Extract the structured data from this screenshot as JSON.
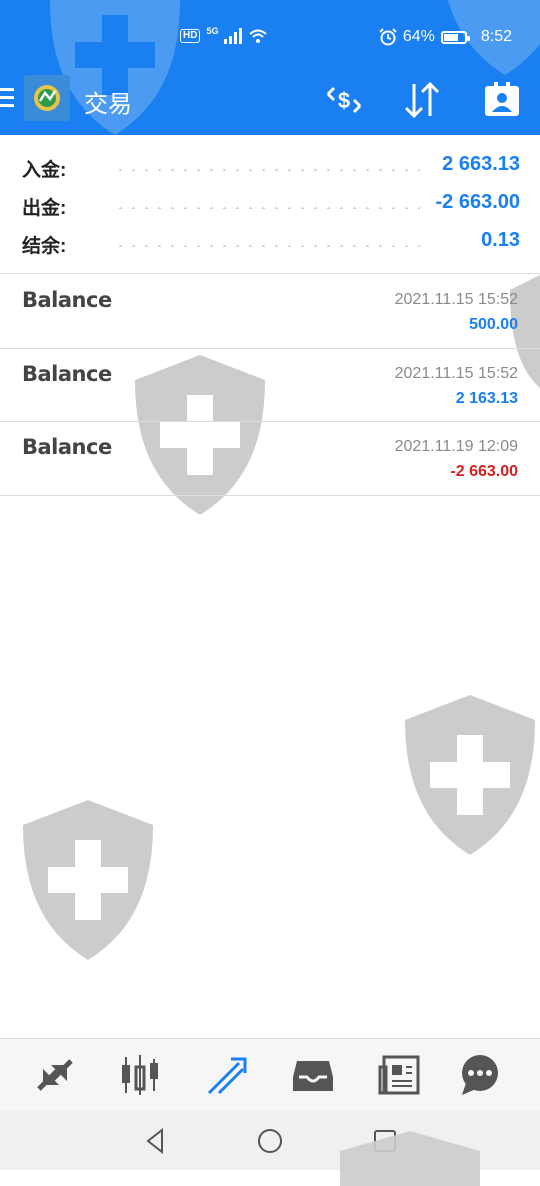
{
  "status_bar": {
    "network_badge": "HD",
    "network_type": "5G",
    "battery_percent": "64%",
    "battery_level": 0.64,
    "time": "8:52"
  },
  "app_bar": {
    "title": "交易",
    "icons": [
      "menu-icon",
      "app-logo",
      "exchange-dollar-icon",
      "sort-arrows-icon",
      "contact-card-icon"
    ]
  },
  "summary": {
    "deposit_label": "入金:",
    "deposit_value": "2 663.13",
    "withdraw_label": "出金:",
    "withdraw_value": "-2 663.00",
    "balance_label": "结余:",
    "balance_value": "0.13"
  },
  "entries": [
    {
      "type": "Balance",
      "time": "2021.11.15 15:52",
      "amount": "500.00",
      "sign": "positive"
    },
    {
      "type": "Balance",
      "time": "2021.11.15 15:52",
      "amount": "2 163.13",
      "sign": "positive"
    },
    {
      "type": "Balance",
      "time": "2021.11.19 12:09",
      "amount": "-2 663.00",
      "sign": "negative"
    }
  ],
  "bottom_nav": {
    "items": [
      "quotes-icon",
      "chart-candles-icon",
      "trade-icon",
      "history-inbox-icon",
      "news-icon",
      "chat-icon"
    ],
    "active": "trade-icon"
  },
  "colors": {
    "accent": "#1a7ff0",
    "negative": "#d32020",
    "watermark": "#cccccc"
  }
}
